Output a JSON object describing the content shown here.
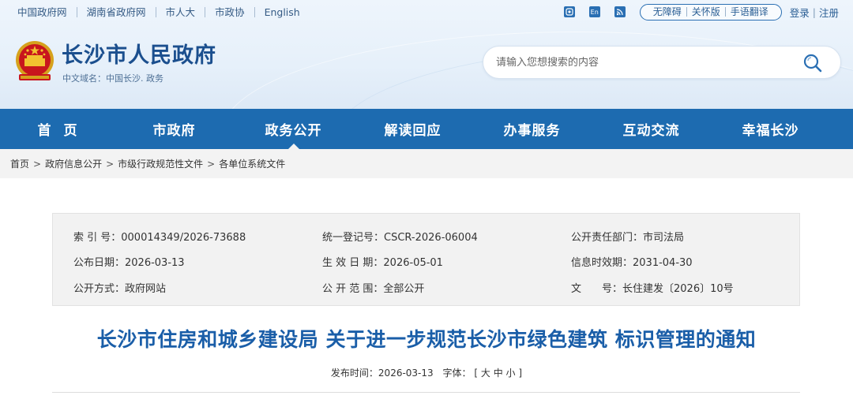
{
  "top_links": [
    "中国政府网",
    "湖南省政府网",
    "市人大",
    "市政协",
    "English"
  ],
  "top_right": {
    "icons": [
      "weibo-icon",
      "en-icon",
      "rss-icon"
    ],
    "icon_en_text": "En",
    "accessibility": [
      "无障碍",
      "关怀版",
      "手语翻译"
    ],
    "login": "登录",
    "separator": "|",
    "register": "注册"
  },
  "logo": {
    "title": "长沙市人民政府",
    "subtitle": "中文域名：中国长沙. 政务"
  },
  "search": {
    "placeholder": "请输入您想搜索的内容"
  },
  "nav": {
    "items": [
      "首页",
      "市政府",
      "政务公开",
      "解读回应",
      "办事服务",
      "互动交流",
      "幸福长沙"
    ],
    "active_index": 2
  },
  "breadcrumb": [
    "首页",
    "政府信息公开",
    "市级行政规范性文件",
    "各单位系统文件"
  ],
  "info": {
    "index_label": "索 引 号：",
    "index_value": "000014349/2026-73688",
    "reg_label": "统一登记号：",
    "reg_value": "CSCR-2026-06004",
    "dept_label": "公开责任部门：",
    "dept_value": "市司法局",
    "pub_date_label": "公布日期：",
    "pub_date_value": "2026-03-13",
    "eff_date_label": "生 效 日 期：",
    "eff_date_value": "2026-05-01",
    "expiry_label": "信息时效期：",
    "expiry_value": "2031-04-30",
    "method_label": "公开方式：",
    "method_value": "政府网站",
    "scope_label": "公 开 范 围：",
    "scope_value": "全部公开",
    "docno_label": "文　　号：",
    "docno_value": "长住建发〔2026〕10号"
  },
  "article": {
    "title": "长沙市住房和城乡建设局 关于进一步规范长沙市绿色建筑 标识管理的通知",
    "publish_label": "发布时间：",
    "publish_date": "2026-03-13",
    "font_label": "字体：",
    "font_open": "[",
    "font_large": "大",
    "font_medium": "中",
    "font_small": "小",
    "font_close": "]"
  },
  "colors": {
    "nav_bg": "#1d6bb0",
    "title": "#1a5ea8",
    "logo": "#1b4f8e"
  }
}
